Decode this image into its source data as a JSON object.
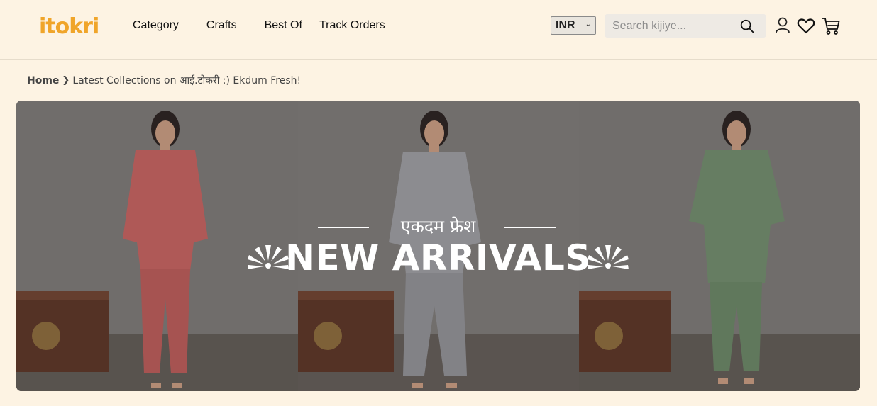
{
  "brand": {
    "logo_text": "itokri",
    "accent_color": "#f0a52a"
  },
  "nav": {
    "items": [
      {
        "label": "Category"
      },
      {
        "label": "Crafts"
      },
      {
        "label": "Best Of"
      },
      {
        "label": "Track Orders"
      }
    ]
  },
  "currency": {
    "selected": "INR"
  },
  "search": {
    "placeholder": "Search kijiye...",
    "value": ""
  },
  "header_icons": [
    "user-icon",
    "heart-icon",
    "cart-icon",
    "search-icon"
  ],
  "breadcrumb": {
    "home": "Home",
    "current": "Latest Collections on आई.टोकरी :) Ekdum Fresh!"
  },
  "banner": {
    "eyebrow": "एकदम फ्रेश",
    "title": "NEW ARRIVALS",
    "panels": [
      {
        "outfit_color": "#c2615f",
        "pattern_color": "#e7c9bd"
      },
      {
        "outfit_color": "#9a9ba0",
        "pattern_color": "#cfd0d3"
      },
      {
        "outfit_color": "#6f8a6c",
        "pattern_color": "#c98f8f"
      }
    ]
  },
  "colors": {
    "page_bg": "#fdf3e3",
    "banner_wall": "#6d6b69"
  }
}
